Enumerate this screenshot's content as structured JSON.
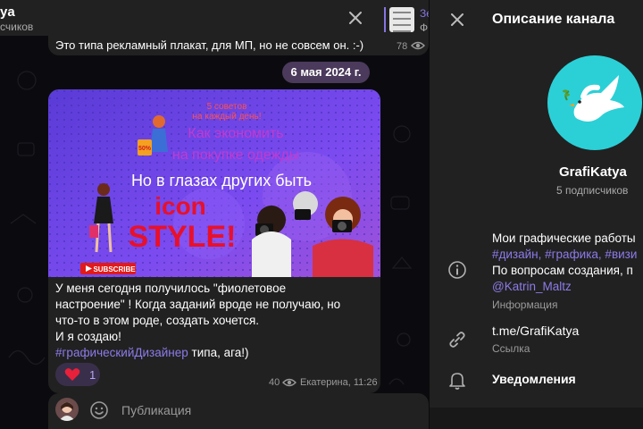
{
  "chat": {
    "title": "ya",
    "subtitle": "счиков",
    "pinned": {
      "line1": "Зе",
      "line2": "Ф"
    },
    "previous_message": {
      "text": "Это типа рекламный плакат, для МП, но не совсем он. :-)",
      "views": "78"
    },
    "date": "6 мая 2024 г.",
    "post": {
      "image": {
        "lines": [
          "5 советов",
          "на каждый день!",
          "Как экономить",
          "на покупке одежды",
          "Но в глазах других быть",
          "icon",
          "STYLE!"
        ],
        "badge": "SUBSCRIBE",
        "sale": "50%"
      },
      "text_lines": [
        "У меня сегодня получилось \"фиолетовое",
        "настроение\" !  Когда заданий вроде не получаю, но",
        "что-то в этом роде, создать хочется.",
        "И я создаю!"
      ],
      "hashtag": "#графическийДизайнер",
      "hashtag_tail": " типа, ага!)",
      "reaction": {
        "emoji": "heart",
        "count": "1"
      },
      "views": "40",
      "author_time": "Екатерина, 11:26"
    },
    "composer": {
      "placeholder": "Публикация"
    }
  },
  "panel": {
    "title": "Описание канала",
    "channel_name": "GrafiKatya",
    "subscribers": "5 подписчиков",
    "description": {
      "line1": "Мои графические работы",
      "tags": "#дизайн, #графика, #визи",
      "line3": "По вопросам  создания, п",
      "mention": "@Katrin_Maltz",
      "label": "Информация"
    },
    "link": {
      "value": "t.me/GrafiKatya",
      "label": "Ссылка"
    },
    "notifications": "Уведомления"
  },
  "colors": {
    "accent": "#8774e1",
    "panel": "#212121",
    "background": "#0b0b0f",
    "image_bg": "#6a3fe8"
  }
}
